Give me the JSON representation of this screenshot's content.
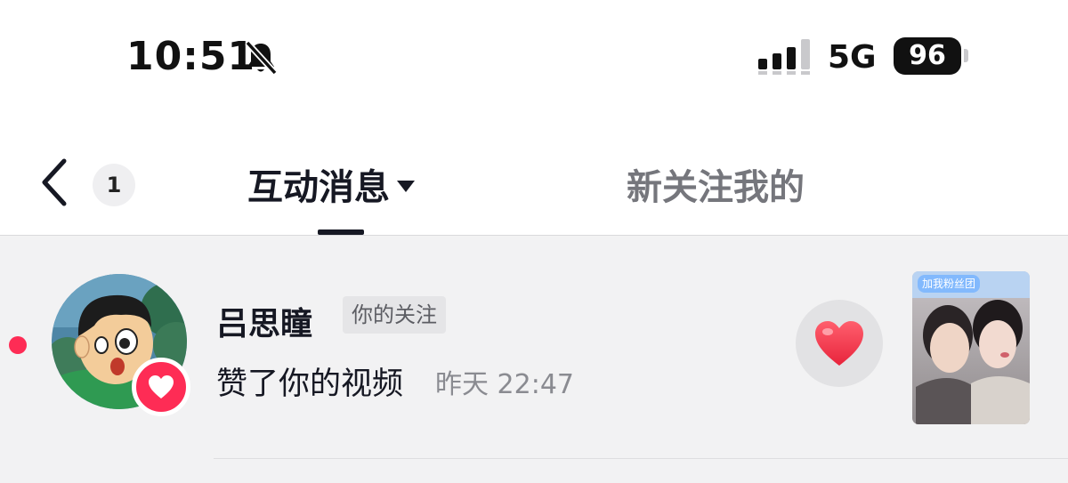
{
  "status_bar": {
    "time": "10:51",
    "network": "5G",
    "battery": "96",
    "icons": [
      "bell-off-icon",
      "signal-icon",
      "battery-icon"
    ]
  },
  "nav": {
    "unread_count": "1",
    "active_tab": "互动消息",
    "inactive_tab": "新关注我的",
    "icons": [
      "chevron-left-icon",
      "caret-down-icon"
    ]
  },
  "notifications": [
    {
      "username": "吕思瞳",
      "tag": "你的关注",
      "action": "赞了你的视频",
      "time": "昨天 22:47",
      "thumbnail_tag": "加我粉丝团",
      "icons": [
        "avatar-image",
        "heart-badge-icon",
        "heart-icon",
        "video-thumbnail"
      ]
    }
  ],
  "colors": {
    "accent": "#fe2c55",
    "list_background": "#f2f2f3",
    "text_primary": "#161823",
    "text_secondary": "#8a8b91"
  }
}
